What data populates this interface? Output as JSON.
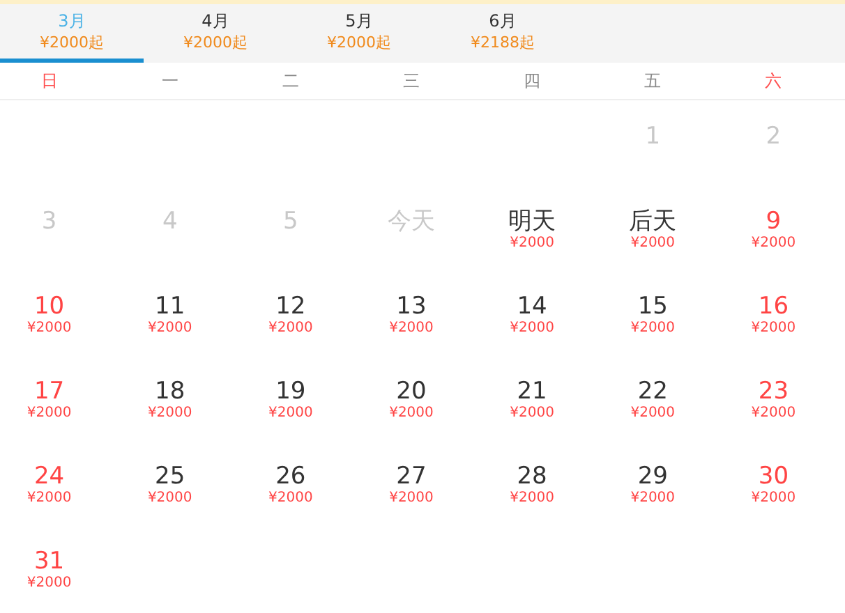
{
  "month_tabs": [
    {
      "label": "3月",
      "price": "¥2000起",
      "selected": true
    },
    {
      "label": "4月",
      "price": "¥2000起",
      "selected": false
    },
    {
      "label": "5月",
      "price": "¥2000起",
      "selected": false
    },
    {
      "label": "6月",
      "price": "¥2188起",
      "selected": false
    }
  ],
  "weekdays": [
    {
      "label": "日",
      "weekend": true
    },
    {
      "label": "一",
      "weekend": false
    },
    {
      "label": "二",
      "weekend": false
    },
    {
      "label": "三",
      "weekend": false
    },
    {
      "label": "四",
      "weekend": false
    },
    {
      "label": "五",
      "weekend": false
    },
    {
      "label": "六",
      "weekend": true
    }
  ],
  "days": [
    {
      "kind": "blank"
    },
    {
      "kind": "blank"
    },
    {
      "kind": "blank"
    },
    {
      "kind": "blank"
    },
    {
      "kind": "blank"
    },
    {
      "kind": "past",
      "label": "1"
    },
    {
      "kind": "past",
      "label": "2"
    },
    {
      "kind": "past",
      "label": "3"
    },
    {
      "kind": "past",
      "label": "4"
    },
    {
      "kind": "past",
      "label": "5"
    },
    {
      "kind": "past",
      "label": "今天"
    },
    {
      "kind": "open",
      "label": "明天",
      "price": "¥2000",
      "weekend": false
    },
    {
      "kind": "open",
      "label": "后天",
      "price": "¥2000",
      "weekend": false
    },
    {
      "kind": "open",
      "label": "9",
      "price": "¥2000",
      "weekend": true
    },
    {
      "kind": "open",
      "label": "10",
      "price": "¥2000",
      "weekend": true
    },
    {
      "kind": "open",
      "label": "11",
      "price": "¥2000",
      "weekend": false
    },
    {
      "kind": "open",
      "label": "12",
      "price": "¥2000",
      "weekend": false
    },
    {
      "kind": "open",
      "label": "13",
      "price": "¥2000",
      "weekend": false
    },
    {
      "kind": "open",
      "label": "14",
      "price": "¥2000",
      "weekend": false
    },
    {
      "kind": "open",
      "label": "15",
      "price": "¥2000",
      "weekend": false
    },
    {
      "kind": "open",
      "label": "16",
      "price": "¥2000",
      "weekend": true
    },
    {
      "kind": "open",
      "label": "17",
      "price": "¥2000",
      "weekend": true
    },
    {
      "kind": "open",
      "label": "18",
      "price": "¥2000",
      "weekend": false
    },
    {
      "kind": "open",
      "label": "19",
      "price": "¥2000",
      "weekend": false
    },
    {
      "kind": "open",
      "label": "20",
      "price": "¥2000",
      "weekend": false
    },
    {
      "kind": "open",
      "label": "21",
      "price": "¥2000",
      "weekend": false
    },
    {
      "kind": "open",
      "label": "22",
      "price": "¥2000",
      "weekend": false
    },
    {
      "kind": "open",
      "label": "23",
      "price": "¥2000",
      "weekend": true
    },
    {
      "kind": "open",
      "label": "24",
      "price": "¥2000",
      "weekend": true
    },
    {
      "kind": "open",
      "label": "25",
      "price": "¥2000",
      "weekend": false
    },
    {
      "kind": "open",
      "label": "26",
      "price": "¥2000",
      "weekend": false
    },
    {
      "kind": "open",
      "label": "27",
      "price": "¥2000",
      "weekend": false
    },
    {
      "kind": "open",
      "label": "28",
      "price": "¥2000",
      "weekend": false
    },
    {
      "kind": "open",
      "label": "29",
      "price": "¥2000",
      "weekend": false
    },
    {
      "kind": "open",
      "label": "30",
      "price": "¥2000",
      "weekend": true
    },
    {
      "kind": "open",
      "label": "31",
      "price": "¥2000",
      "weekend": true
    }
  ]
}
